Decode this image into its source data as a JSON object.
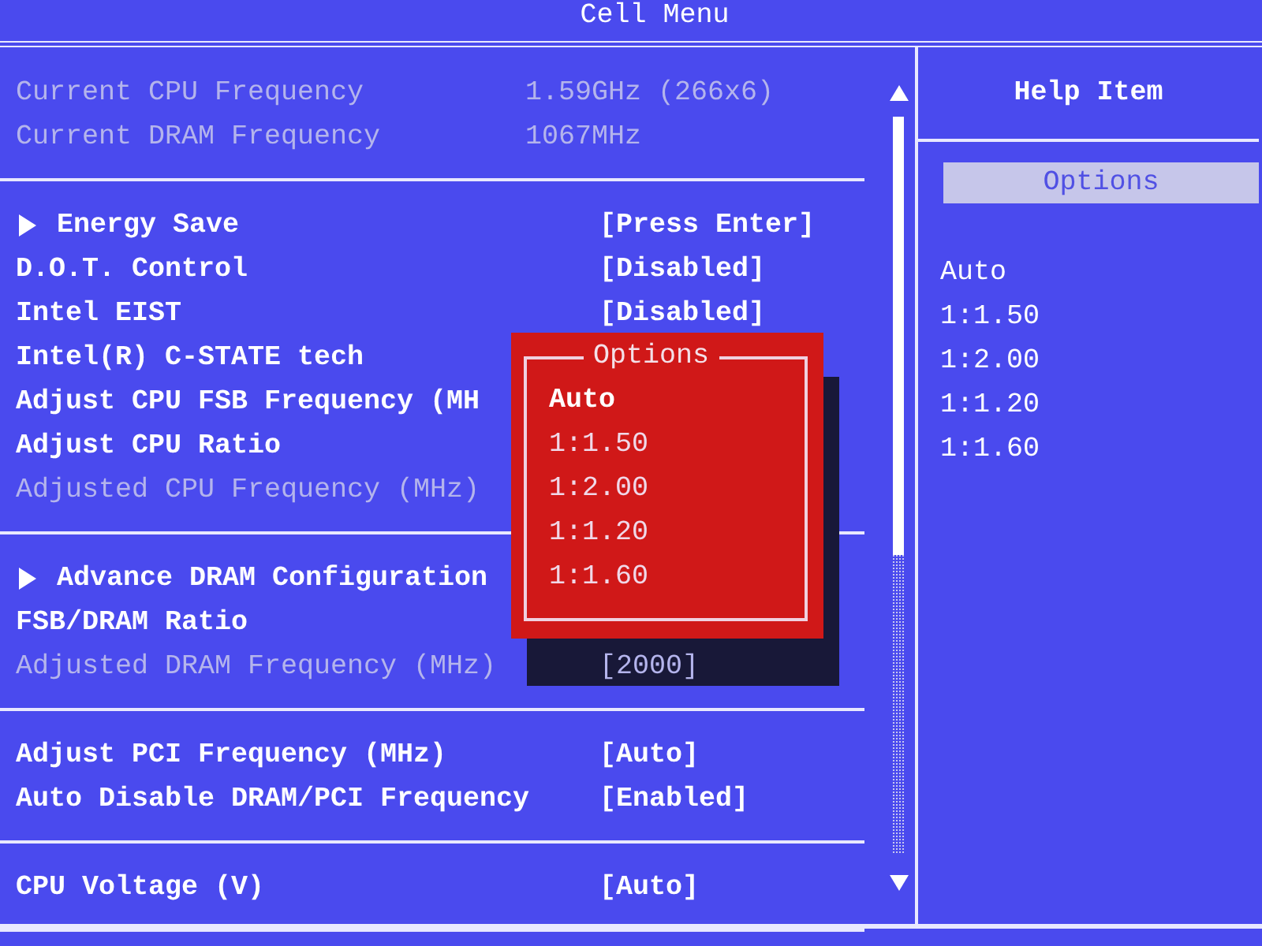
{
  "header": {
    "title": "Cell Menu"
  },
  "groups": [
    {
      "rows": [
        {
          "kind": "info",
          "label": "Current CPU Frequency",
          "value": "1.59GHz (266x6)",
          "disabled": true
        },
        {
          "kind": "info",
          "label": "Current DRAM Frequency",
          "value": "1067MHz",
          "disabled": true
        }
      ]
    },
    {
      "rows": [
        {
          "kind": "submenu",
          "label": "Energy Save",
          "value": "[Press Enter]",
          "disabled": false
        },
        {
          "kind": "setting",
          "label": "D.O.T. Control",
          "value": "[Disabled]",
          "disabled": false
        },
        {
          "kind": "setting",
          "label": "Intel EIST",
          "value": "[Disabled]",
          "disabled": false
        },
        {
          "kind": "setting",
          "label": "Intel(R) C-STATE tech",
          "disabled": false
        },
        {
          "kind": "setting",
          "label": "Adjust CPU FSB Frequency (MH",
          "disabled": false
        },
        {
          "kind": "setting",
          "label": "Adjust CPU Ratio",
          "disabled": false
        },
        {
          "kind": "setting",
          "label": "Adjusted CPU Frequency (MHz)",
          "disabled": true
        }
      ]
    },
    {
      "rows": [
        {
          "kind": "submenu",
          "label": "Advance DRAM Configuration",
          "disabled": false
        },
        {
          "kind": "setting",
          "label": "FSB/DRAM Ratio",
          "disabled": false
        },
        {
          "kind": "setting",
          "label": "Adjusted DRAM Frequency (MHz)",
          "value": "[2000]",
          "disabled": true
        }
      ]
    },
    {
      "rows": [
        {
          "kind": "setting",
          "label": "Adjust PCI Frequency (MHz)",
          "value": "[Auto]",
          "disabled": false
        },
        {
          "kind": "setting",
          "label": "Auto Disable DRAM/PCI Frequency",
          "value": "[Enabled]",
          "disabled": false
        }
      ]
    },
    {
      "rows": [
        {
          "kind": "setting",
          "label": "CPU Voltage (V)",
          "value": "[Auto]",
          "disabled": false
        }
      ]
    }
  ],
  "popup": {
    "title": "Options",
    "options": [
      {
        "label": "Auto",
        "selected": true
      },
      {
        "label": "1:1.50",
        "selected": false
      },
      {
        "label": "1:2.00",
        "selected": false
      },
      {
        "label": "1:1.20",
        "selected": false
      },
      {
        "label": "1:1.60",
        "selected": false
      }
    ]
  },
  "help": {
    "title": "Help Item",
    "section": "Options",
    "lines": [
      "Auto",
      "1:1.50",
      "1:2.00",
      "1:1.20",
      "1:1.60"
    ]
  }
}
